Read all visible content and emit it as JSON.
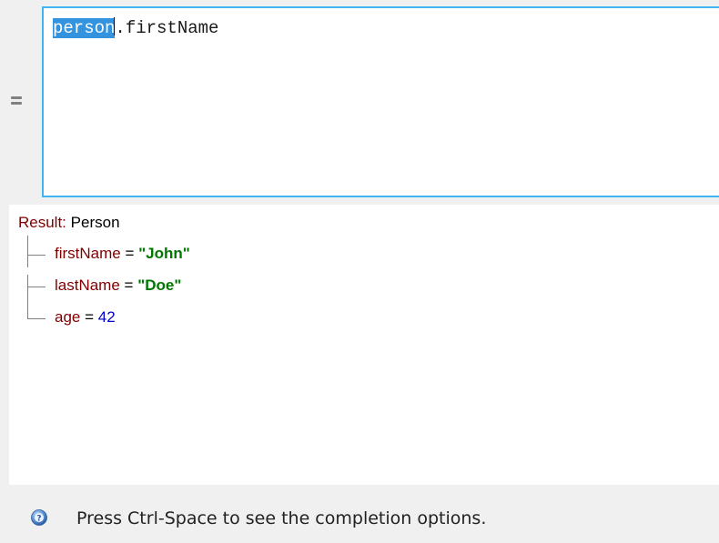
{
  "editor": {
    "selected_token": "person",
    "rest_of_expression": ".firstName"
  },
  "result": {
    "label": "Result:",
    "type": "Person",
    "fields": [
      {
        "name": "firstName",
        "operator": " = ",
        "value": "\"John\"",
        "kind": "string"
      },
      {
        "name": "lastName",
        "operator": " = ",
        "value": "\"Doe\"",
        "kind": "string"
      },
      {
        "name": "age",
        "operator": " = ",
        "value": "42",
        "kind": "number"
      }
    ]
  },
  "status_bar": {
    "icon": "info-icon",
    "message": "Press Ctrl-Space to see the completion options."
  },
  "colors": {
    "editor_border": "#3bb7f1",
    "selection": "#3393df",
    "field_name": "#800000",
    "string_value": "#007700",
    "number_value": "#0000cc"
  }
}
